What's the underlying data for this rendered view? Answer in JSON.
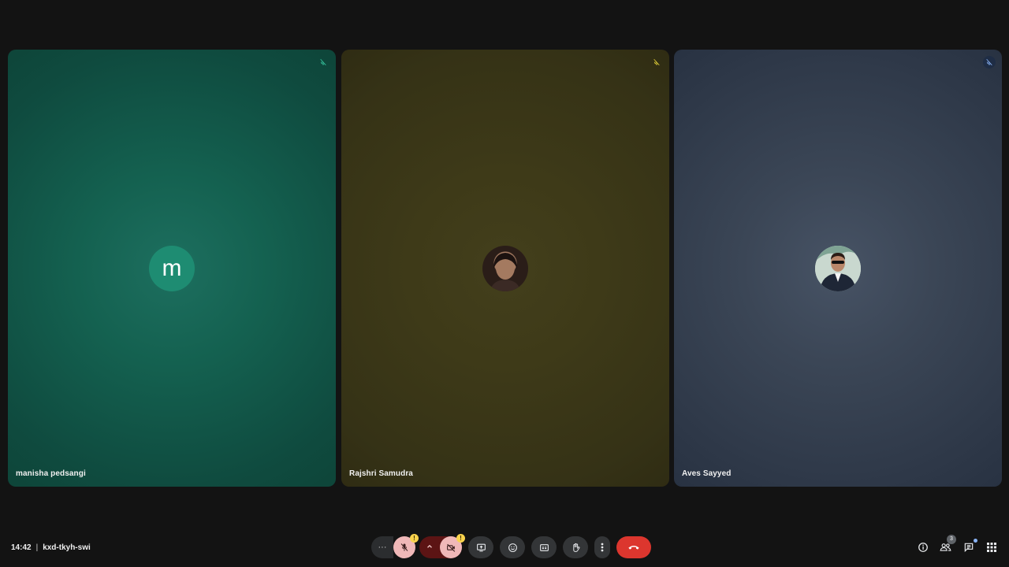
{
  "participants": [
    {
      "name": "manisha pedsangi",
      "avatar_type": "letter",
      "avatar_letter": "m",
      "muted": true,
      "tile_color": "#146150",
      "mic_icon": "mic-off-icon"
    },
    {
      "name": "Rajshri Samudra",
      "avatar_type": "photo",
      "muted": true,
      "tile_color": "#3e3a18",
      "mic_icon": "mic-off-icon"
    },
    {
      "name": "Aves Sayyed",
      "avatar_type": "photo",
      "muted": true,
      "tile_color": "#3b4656",
      "mic_icon": "mic-off-icon"
    }
  ],
  "meeting": {
    "time": "14:42",
    "separator": "|",
    "code": "kxd-tkyh-swi"
  },
  "controls": {
    "more_options_left": "···",
    "mic_warning": "!",
    "cam_warning": "!",
    "icons": [
      "mic-off-icon",
      "chevron-up-icon",
      "camera-off-icon",
      "present-screen-icon",
      "emoji-icon",
      "captions-icon",
      "raise-hand-icon",
      "more-vert-icon",
      "end-call-icon"
    ],
    "end_call_color": "#dc362e"
  },
  "right_panel": {
    "people_count": "3",
    "icons": [
      "info-icon",
      "people-icon",
      "chat-icon",
      "activities-icon"
    ]
  }
}
